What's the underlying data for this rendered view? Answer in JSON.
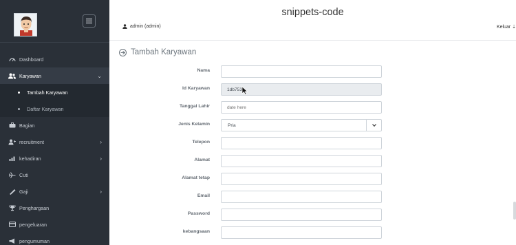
{
  "header": {
    "title": "snippets-code",
    "user": "admin (admin)",
    "logout": "Keluar"
  },
  "sidebar": {
    "items": [
      {
        "label": "Dashboard",
        "icon": "dashboard-icon"
      },
      {
        "label": "Karyawan",
        "icon": "users-icon",
        "expanded": true
      },
      {
        "label": "Bagian",
        "icon": "briefcase-icon"
      },
      {
        "label": "recruitment",
        "icon": "user-plus-icon"
      },
      {
        "label": "kehadiran",
        "icon": "bar-chart-icon"
      },
      {
        "label": "Cuti",
        "icon": "plane-icon"
      },
      {
        "label": "Gaji",
        "icon": "money-icon"
      },
      {
        "label": "Penghargaan",
        "icon": "trophy-icon"
      },
      {
        "label": "pengeluaran",
        "icon": "credit-card-icon"
      },
      {
        "label": "pengumuman",
        "icon": "bullhorn-icon"
      }
    ],
    "karyawan_sub": [
      {
        "label": "Tambah Karyawan"
      },
      {
        "label": "Daftar Karyawan"
      }
    ]
  },
  "main": {
    "title": "Tambah Karyawan",
    "form": {
      "nama": {
        "label": "Nama",
        "value": ""
      },
      "id_karyawan": {
        "label": "Id Karyawan",
        "value": "1db753"
      },
      "tanggal_lahir": {
        "label": "Tanggal Lahir",
        "placeholder": "date here"
      },
      "jenis_kelamin": {
        "label": "Jenis Kelamin",
        "value": "Pria"
      },
      "telepon": {
        "label": "Telepon",
        "value": ""
      },
      "alamat": {
        "label": "Alamat",
        "value": ""
      },
      "alamat_tetap": {
        "label": "Alamat tetap",
        "value": ""
      },
      "email": {
        "label": "Email",
        "value": ""
      },
      "password": {
        "label": "Password",
        "value": ""
      },
      "kebangsaan": {
        "label": "kebangsaan",
        "value": ""
      }
    }
  },
  "colors": {
    "sidebar_bg": "#2a3038",
    "sidebar_active": "#353c46",
    "submenu_bg": "#232930",
    "readonly_bg": "#e9ecef"
  }
}
